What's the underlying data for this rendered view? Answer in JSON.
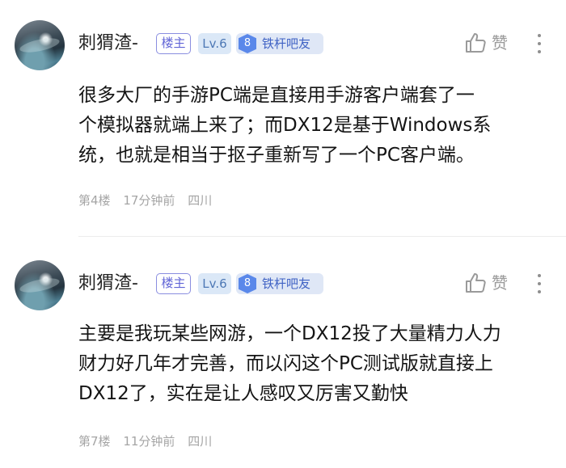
{
  "comments": [
    {
      "username": "刺猬渣-",
      "owner_badge": "楼主",
      "level": "Lv.6",
      "fan_level": "8",
      "fan_badge": "铁杆吧友",
      "like_label": "赞",
      "content_lines": [
        "很多大厂的手游PC端是直接用手游客户端套了一",
        "个模拟器就端上来了；而DX12是基于Windows系",
        "统，也就是相当于抠子重新写了一个PC客户端。"
      ],
      "floor": "第4楼",
      "time": "17分钟前",
      "location": "四川"
    },
    {
      "username": "刺猬渣-",
      "owner_badge": "楼主",
      "level": "Lv.6",
      "fan_level": "8",
      "fan_badge": "铁杆吧友",
      "like_label": "赞",
      "content_lines": [
        "主要是我玩某些网游，一个DX12投了大量精力人力",
        "财力好几年才完善，而以闪这个PC测试版就直接上",
        "DX12了，实在是让人感叹又厉害又勤快"
      ],
      "floor": "第7楼",
      "time": "11分钟前",
      "location": "四川"
    }
  ],
  "colors": {
    "owner_badge": "#6064d6",
    "level_badge": "#4d78b5",
    "fan_badge": "#3f62c4",
    "meta_text": "#a5a5a5"
  },
  "icons": {
    "like": "thumbs-up-icon",
    "more": "more-vertical-icon"
  }
}
